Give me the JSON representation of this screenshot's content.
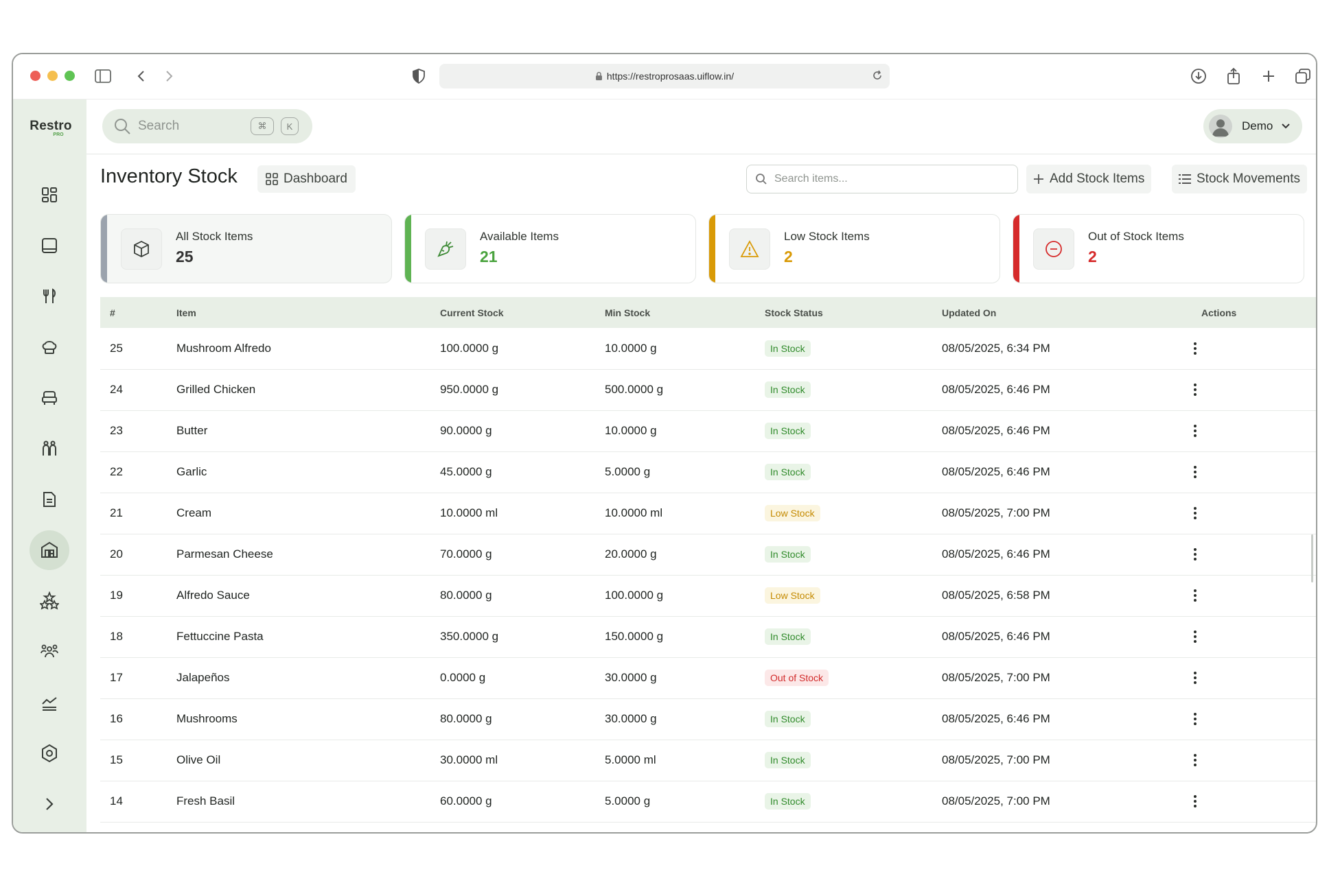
{
  "browser": {
    "url": "https://restroprosaas.uiflow.in/"
  },
  "brand": {
    "name": "Restro",
    "tag": "PRO"
  },
  "topbar": {
    "search_placeholder": "Search",
    "kbd_cmd": "⌘",
    "kbd_k": "K",
    "user_name": "Demo"
  },
  "page": {
    "title": "Inventory Stock",
    "dashboard_label": "Dashboard",
    "search_placeholder": "Search items...",
    "add_label": "Add Stock Items",
    "movements_label": "Stock Movements"
  },
  "stats": [
    {
      "label": "All Stock Items",
      "value": "25",
      "color": "#9ba3ad"
    },
    {
      "label": "Available Items",
      "value": "21",
      "color": "#5fb353"
    },
    {
      "label": "Low Stock Items",
      "value": "2",
      "color": "#d99a06"
    },
    {
      "label": "Out of Stock Items",
      "value": "2",
      "color": "#d62b2b"
    }
  ],
  "table": {
    "headers": [
      "#",
      "Item",
      "Current Stock",
      "Min Stock",
      "Stock Status",
      "Updated On",
      "Actions"
    ],
    "rows": [
      {
        "id": "25",
        "item": "Mushroom Alfredo",
        "current": "100.0000 g",
        "min": "10.0000 g",
        "status": "In Stock",
        "updated": "08/05/2025, 6:34 PM"
      },
      {
        "id": "24",
        "item": "Grilled Chicken",
        "current": "950.0000 g",
        "min": "500.0000 g",
        "status": "In Stock",
        "updated": "08/05/2025, 6:46 PM"
      },
      {
        "id": "23",
        "item": "Butter",
        "current": "90.0000 g",
        "min": "10.0000 g",
        "status": "In Stock",
        "updated": "08/05/2025, 6:46 PM"
      },
      {
        "id": "22",
        "item": "Garlic",
        "current": "45.0000 g",
        "min": "5.0000 g",
        "status": "In Stock",
        "updated": "08/05/2025, 6:46 PM"
      },
      {
        "id": "21",
        "item": "Cream",
        "current": "10.0000 ml",
        "min": "10.0000 ml",
        "status": "Low Stock",
        "updated": "08/05/2025, 7:00 PM"
      },
      {
        "id": "20",
        "item": "Parmesan Cheese",
        "current": "70.0000 g",
        "min": "20.0000 g",
        "status": "In Stock",
        "updated": "08/05/2025, 6:46 PM"
      },
      {
        "id": "19",
        "item": "Alfredo Sauce",
        "current": "80.0000 g",
        "min": "100.0000 g",
        "status": "Low Stock",
        "updated": "08/05/2025, 6:58 PM"
      },
      {
        "id": "18",
        "item": "Fettuccine Pasta",
        "current": "350.0000 g",
        "min": "150.0000 g",
        "status": "In Stock",
        "updated": "08/05/2025, 6:46 PM"
      },
      {
        "id": "17",
        "item": "Jalapeños",
        "current": "0.0000 g",
        "min": "30.0000 g",
        "status": "Out of Stock",
        "updated": "08/05/2025, 7:00 PM"
      },
      {
        "id": "16",
        "item": "Mushrooms",
        "current": "80.0000 g",
        "min": "30.0000 g",
        "status": "In Stock",
        "updated": "08/05/2025, 6:46 PM"
      },
      {
        "id": "15",
        "item": "Olive Oil",
        "current": "30.0000 ml",
        "min": "5.0000 ml",
        "status": "In Stock",
        "updated": "08/05/2025, 7:00 PM"
      },
      {
        "id": "14",
        "item": "Fresh Basil",
        "current": "60.0000 g",
        "min": "5.0000 g",
        "status": "In Stock",
        "updated": "08/05/2025, 7:00 PM"
      }
    ]
  },
  "sidebar_icons": [
    "dashboard-icon",
    "pos-icon",
    "menu-icon",
    "kitchen-icon",
    "orders-icon",
    "staff-icon",
    "reports-icon",
    "inventory-icon",
    "reviews-icon",
    "customers-icon",
    "analytics-icon",
    "settings-icon",
    "expand-icon"
  ]
}
